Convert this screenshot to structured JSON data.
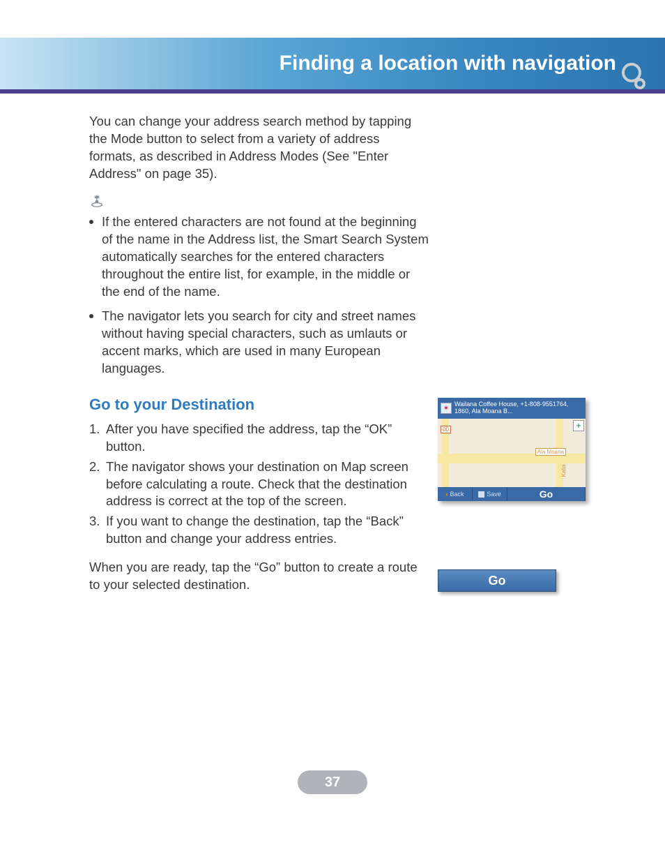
{
  "header": {
    "title": "Finding a location with navigation"
  },
  "intro": "You can change your address search method by tapping the Mode button to select from a variety of address formats, as described in Address Modes (See \"Enter Address\" on page 35).",
  "bullets": [
    "If the entered characters are not found at the beginning of the name in the Address list, the Smart Search System automatically searches for the entered characters throughout the entire list, for example, in the middle or the end of the name.",
    "The navigator lets you search for city and street names without having special characters, such as umlauts or accent marks, which are used in many European languages."
  ],
  "section": {
    "heading": "Go to your Destination"
  },
  "steps": [
    "After you have specified the address, tap the “OK” button.",
    "The navigator shows your destination on Map screen before calculating a route. Check that the destination address is correct at the top of the screen.",
    "If you want to change the destination, tap the “Back” button and change your address entries."
  ],
  "closing": "When you are ready, tap the “Go” button to create a route to your selected destination.",
  "mapshot": {
    "address": "Wailana Coffee House, +1-808-9551764, 1860, Ala Moana B...",
    "badge_num": "00",
    "ala_moana": "Ala Moana",
    "kalia": "Kalia",
    "back": "Back",
    "save": "Save",
    "go": "Go",
    "plus": "+"
  },
  "gobutton": {
    "label": "Go"
  },
  "page_number": "37"
}
